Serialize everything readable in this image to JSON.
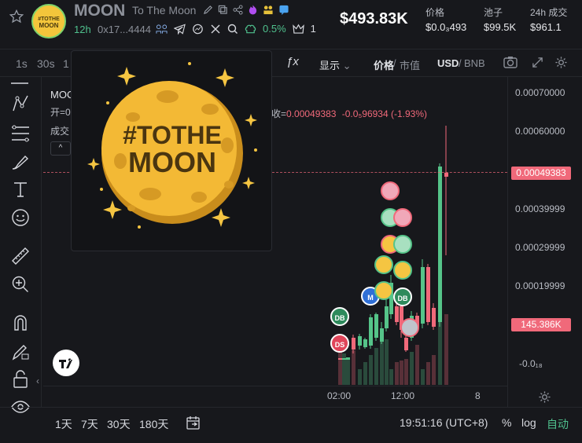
{
  "header": {
    "ticker": "MOON",
    "full_name": "To The Moon",
    "age": "12h",
    "address": "0x17...4444",
    "change_pct": "0.5%",
    "holders_count": "1",
    "market_cap": "$493.83K",
    "stats": [
      {
        "label": "价格",
        "value": "$0.0₃493"
      },
      {
        "label": "池子",
        "value": "$99.5K"
      },
      {
        "label": "24h 成交",
        "value": "$961.1"
      }
    ]
  },
  "toolbar": {
    "timeframes": [
      "1s",
      "30s",
      "1"
    ],
    "fx": "ƒx",
    "display_label": "显示",
    "price_label": "价格",
    "mcap_label": "市值",
    "usd_label": "USD",
    "bnb_label": "BNB"
  },
  "legend": {
    "name_prefix": "MOO",
    "open_prefix": "开=0",
    "volume_prefix": "成交",
    "close_label": "收=",
    "close_value": "0.00049383",
    "change_value": "-0.0₅96934 (-1.93%)"
  },
  "popup": {
    "line1": "#TOTHE",
    "line2": "MOON"
  },
  "y_axis": {
    "ticks": [
      "0.00070000",
      "0.00060000",
      "0.00039999",
      "0.00029999",
      "0.00019999",
      "-0.0₁₈"
    ],
    "price_badge": "0.00049383",
    "volume_badge": "145.386K"
  },
  "x_axis": {
    "ticks": [
      "02:00",
      "12:00",
      "8"
    ]
  },
  "bottom": {
    "ranges": [
      "1天",
      "7天",
      "30天",
      "180天"
    ],
    "clock": "19:51:16 (UTC+8)",
    "percent": "%",
    "log": "log",
    "auto": "自动"
  },
  "markers": [
    {
      "label": "DB",
      "color": "#2e8a5c"
    },
    {
      "label": "DS",
      "color": "#e0455a"
    },
    {
      "label": "M",
      "color": "#2f6fd6"
    },
    {
      "label": "DB",
      "color": "#2e8a5c"
    }
  ],
  "colors": {
    "up": "#55c489",
    "down": "#f0697a",
    "accent": "#4fc08d"
  }
}
